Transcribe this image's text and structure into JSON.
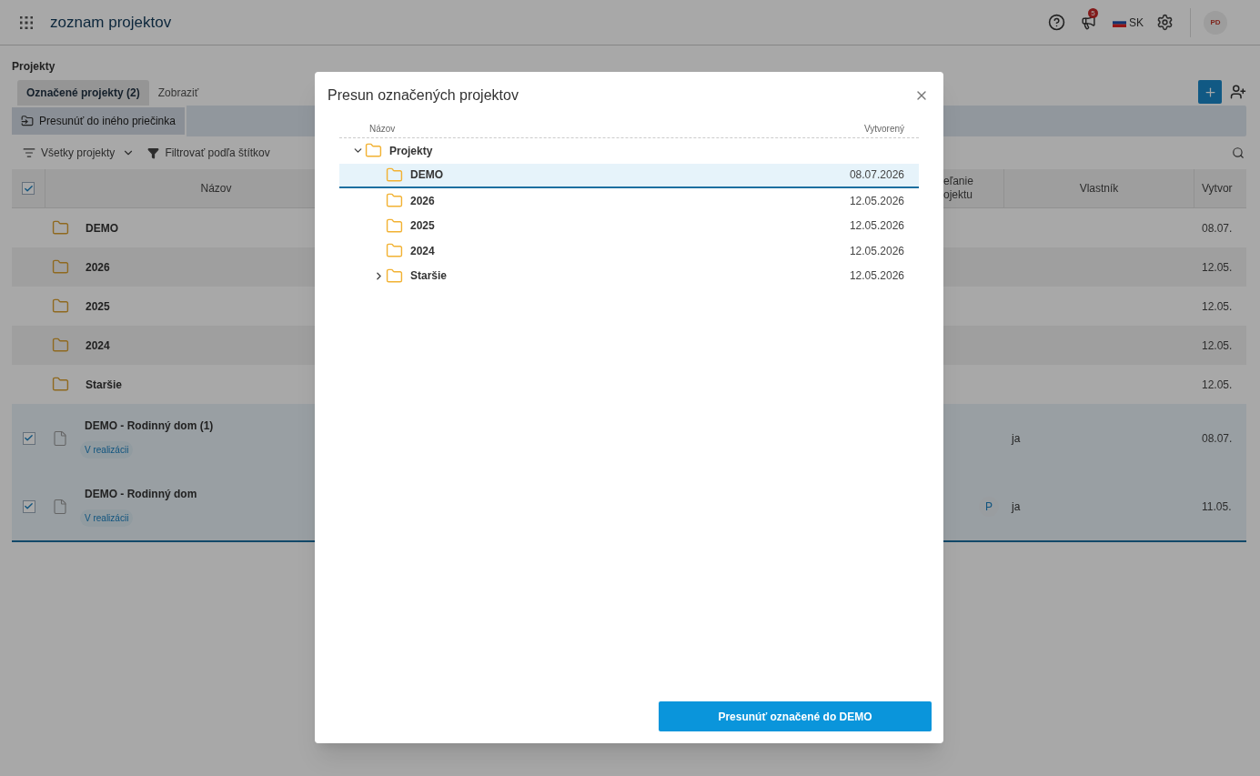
{
  "header": {
    "title": "zoznam projektov",
    "notification_count": "5",
    "language": "SK",
    "avatar": "PD"
  },
  "page": {
    "section_title": "Projekty",
    "tabs": [
      {
        "label": "Označené projekty (2)",
        "selected": true
      },
      {
        "label": "Zobraziť",
        "selected": false
      }
    ],
    "action": "Presunúť do iného priečinka",
    "filters": [
      "Všetky projekty",
      "Filtrovať podľa štítkov"
    ]
  },
  "table": {
    "all_checked": true,
    "columns": [
      "Názov",
      "eľanie ojektu",
      "Vlastník",
      "Vytvor"
    ],
    "rows": [
      {
        "kind": "folder",
        "name": "DEMO",
        "created": "08.07."
      },
      {
        "kind": "folder",
        "name": "2026",
        "created": "12.05."
      },
      {
        "kind": "folder",
        "name": "2025",
        "created": "12.05."
      },
      {
        "kind": "folder",
        "name": "2024",
        "created": "12.05."
      },
      {
        "kind": "folder",
        "name": "Staršie",
        "created": "12.05."
      },
      {
        "kind": "project",
        "name": "DEMO - Rodinný dom (1)",
        "tag": "V realizácii",
        "checked": true,
        "owner": "ja",
        "created": "08.07."
      },
      {
        "kind": "project",
        "name": "DEMO - Rodinný dom",
        "tag": "V realizácii",
        "checked": true,
        "column_3": "P",
        "owner": "ja",
        "created": "11.05."
      }
    ]
  },
  "dialog": {
    "title": "Presun označených projektov",
    "columns": [
      "Názov",
      "Vytvorený"
    ],
    "tree": [
      {
        "name": "Projekty",
        "expanded": true,
        "selected": false,
        "children": [
          {
            "name": "DEMO",
            "created": "08.07.2026",
            "selected": true
          },
          {
            "name": "2026",
            "created": "12.05.2026",
            "selected": false
          },
          {
            "name": "2025",
            "created": "12.05.2026",
            "selected": false
          },
          {
            "name": "2024",
            "created": "12.05.2026",
            "selected": false
          },
          {
            "name": "Staršie",
            "created": "12.05.2026",
            "expanded": false,
            "selected": false
          }
        ]
      }
    ],
    "button": "Presunúť označené do DEMO"
  }
}
